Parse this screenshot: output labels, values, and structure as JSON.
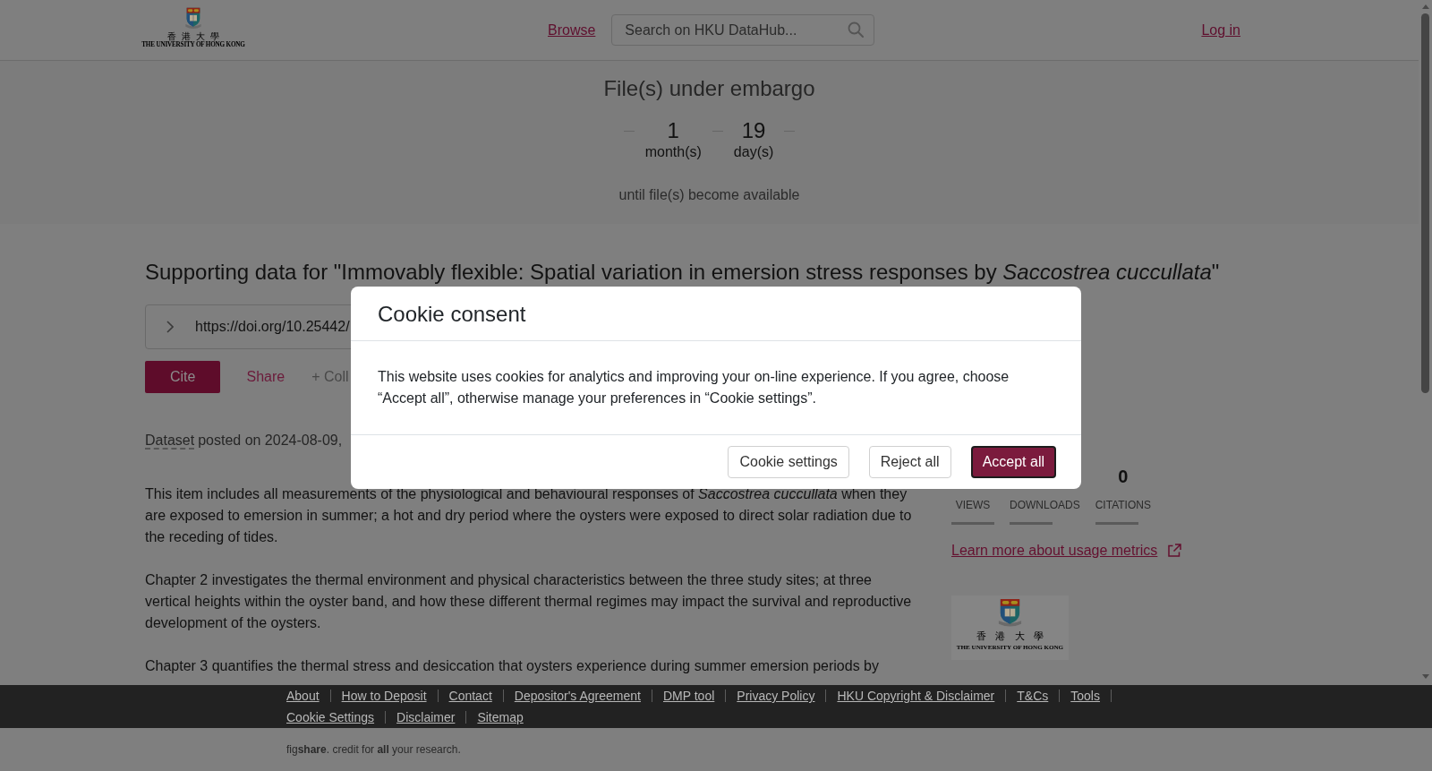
{
  "header": {
    "logo": {
      "chinese": "香 港 大 學",
      "english": "THE UNIVERSITY OF HONG KONG"
    },
    "nav_link": "Browse",
    "search": {
      "placeholder": "Search on HKU DataHub..."
    },
    "login": "Log in"
  },
  "embargo": {
    "title": "File(s) under embargo",
    "countdown": [
      {
        "value": "1",
        "unit": "month(s)"
      },
      {
        "value": "19",
        "unit": "day(s)"
      }
    ],
    "note": "until file(s) become available"
  },
  "item": {
    "title": "Supporting data for \"Immovably flexible: Spatial variation in emersion stress responses by *Saccostrea cuccullata*\"",
    "doi": "https://doi.org/10.25442/",
    "actions": [
      {
        "label": "Cite",
        "kind": "primary"
      },
      {
        "label": "Share",
        "kind": "link"
      },
      {
        "label": "+ Coll",
        "kind": "muted"
      }
    ],
    "item_type": "Dataset",
    "posted": "posted on 2024-08-09,",
    "description": [
      "This item includes all measurements of the physiological and behavioural responses of *Saccostrea cuccullata* when they are exposed to emersion in summer; a hot and dry period where the oysters were exposed to direct solar radiation due to the receding of tides.",
      "Chapter 2 investigates the thermal environment and physical characteristics between the three study sites; at three vertical heights within the oyster band, and how these different thermal regimes may impact the survival and reproductive development of the oysters.",
      "Chapter 3 quantifies the thermal stress and desiccation that oysters experience during summer emersion periods by"
    ]
  },
  "sidebar": {
    "stats": [
      {
        "label": "VIEWS"
      },
      {
        "label": "DOWNLOADS"
      },
      {
        "value": "0",
        "label": "CITATIONS"
      }
    ],
    "metrics_link": "Learn more about usage metrics",
    "logo": {
      "chinese": "香 港 大 學",
      "english": "THE UNIVERSITY OF HONG KONG"
    }
  },
  "cookie_dialog": {
    "title": "Cookie consent",
    "body": "This website uses cookies for analytics and improving your on-line experience. If you agree, choose “Accept all”, otherwise manage your preferences in “Cookie settings”.",
    "buttons": [
      {
        "label": "Cookie settings",
        "kind": "secondary",
        "focused": false
      },
      {
        "label": "Reject all",
        "kind": "secondary",
        "focused": false
      },
      {
        "label": "Accept all",
        "kind": "primary",
        "focused": true
      }
    ]
  },
  "footer": {
    "links": [
      "About",
      "How to Deposit",
      "Contact",
      "Depositor's Agreement",
      "DMP tool",
      "Privacy Policy",
      "HKU Copyright & Disclaimer",
      "T&Cs",
      "Tools",
      "Cookie Settings",
      "Disclaimer",
      "Sitemap"
    ],
    "credit": "fig**share**. credit for **all** your research."
  }
}
